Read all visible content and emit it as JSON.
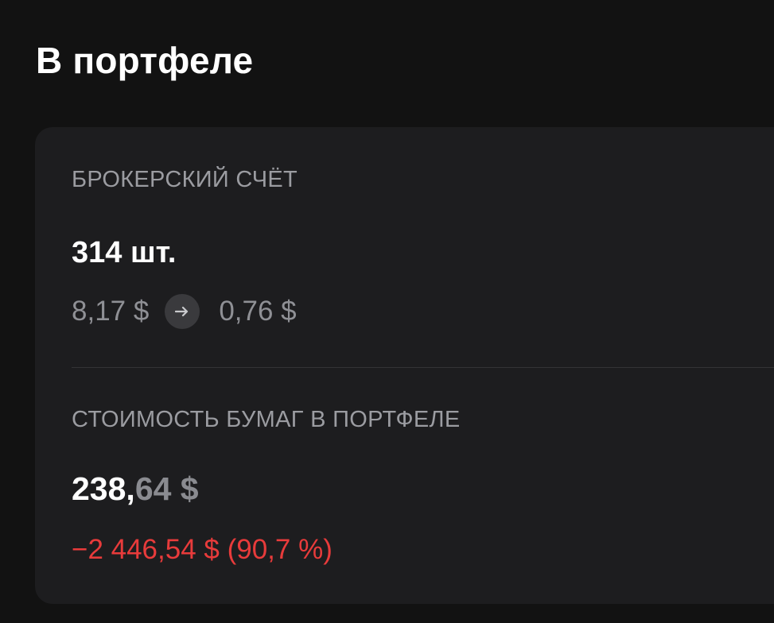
{
  "header": {
    "title": "В портфеле"
  },
  "account": {
    "label": "БРОКЕРСКИЙ СЧЁТ",
    "quantity": "314 шт.",
    "price_from": "8,17 $",
    "price_to": "0,76 $",
    "arrow_icon": "arrow-right-icon"
  },
  "portfolio_value": {
    "label": "СТОИМОСТЬ БУМАГ В ПОРТФЕЛЕ",
    "integer_part": "238,",
    "fraction_part": "64 $",
    "change": "−2 446,54 $ (90,7 %)",
    "change_color": "#e83b3b"
  },
  "colors": {
    "background": "#121212",
    "card": "#1d1d1f",
    "muted_text": "#9b9ca1",
    "negative": "#e83b3b"
  }
}
